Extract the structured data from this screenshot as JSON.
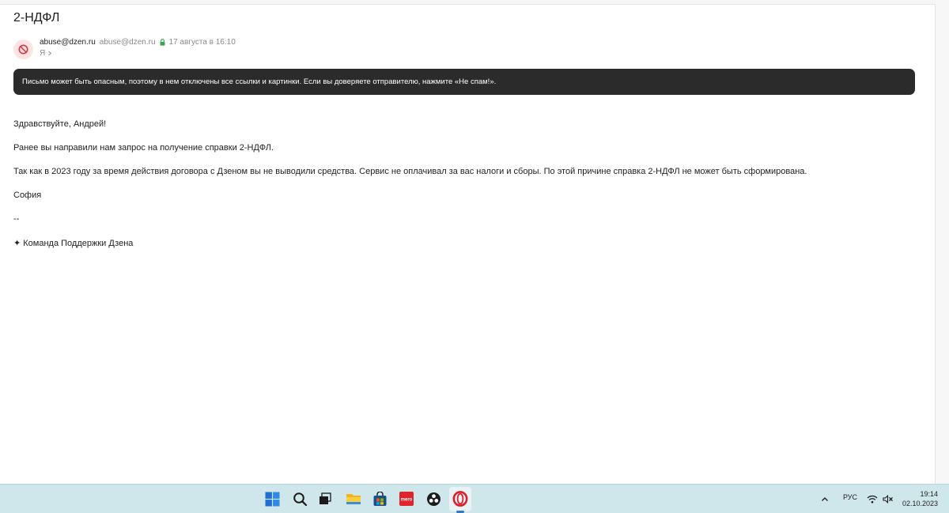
{
  "email": {
    "subject": "2-НДФЛ",
    "sender_name": "abuse@dzen.ru",
    "sender_email": "abuse@dzen.ru",
    "date": "17 августа в 16:10",
    "recipient": "Я",
    "warning": "Письмо может быть опасным, поэтому в нем отключены все ссылки и картинки. Если вы доверяете отправителю, нажмите «Не спам!».",
    "body": {
      "greeting": "Здравствуйте, Андрей!",
      "line1": "Ранее вы направили нам запрос на получение справки 2-НДФЛ.",
      "line2": "Так как в 2023 году за время действия договора с Дзеном вы не выводили средства. Сервис не оплачивал за вас налоги и сборы. По этой причине справка 2-НДФЛ не может быть сформирована.",
      "signature_name": "София",
      "separator": "--",
      "team": "✦ Команда Поддержки Дзена"
    }
  },
  "taskbar": {
    "mts_label": "mero",
    "language": "РУС",
    "time": "19:14",
    "date": "02.10.2023"
  },
  "colors": {
    "banner_bg": "#2b2b2b",
    "taskbar_bg": "#cfe6ea",
    "avatar_bg": "#fde3e3",
    "lock_green": "#3aa655",
    "block_red": "#d9363e"
  }
}
